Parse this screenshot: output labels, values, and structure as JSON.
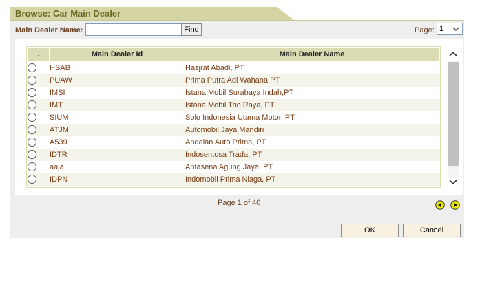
{
  "window": {
    "title": "Browse: Car Main Dealer"
  },
  "filter": {
    "label": "Main Dealer Name:",
    "value": "",
    "find_label": "Find"
  },
  "page_select": {
    "label": "Page:",
    "selected": "1"
  },
  "table": {
    "headers": {
      "select": ".",
      "id": "Main Dealer Id",
      "name": "Main Dealer Name"
    },
    "rows": [
      {
        "id": "HSAB",
        "name": "Hasjrat Abadi, PT"
      },
      {
        "id": "PUAW",
        "name": "Prima Putra Adi Wahana PT"
      },
      {
        "id": "IMSI",
        "name": "Istana Mobil Surabaya Indah,PT"
      },
      {
        "id": "IMT",
        "name": "Istana Mobil Trio Raya, PT"
      },
      {
        "id": "SIUM",
        "name": "Solo Indonesia Utama Motor, PT"
      },
      {
        "id": "ATJM",
        "name": "Automobil Jaya Mandiri"
      },
      {
        "id": "A539",
        "name": "Andalan Auto Prima, PT"
      },
      {
        "id": "IDTR",
        "name": "Indosentosa Trada, PT"
      },
      {
        "id": "aaja",
        "name": "Antasena Agung Jaya, PT"
      },
      {
        "id": "IDPN",
        "name": "Indomobil Prima Niaga, PT"
      }
    ]
  },
  "pager": {
    "text": "Page 1 of 40"
  },
  "buttons": {
    "ok": "OK",
    "cancel": "Cancel"
  },
  "icons": {
    "prev": "prev-page-icon",
    "next": "next-page-icon",
    "scroll_up": "chevron-up-icon",
    "scroll_down": "chevron-down-icon"
  },
  "colors": {
    "title_tab": "#d4d4a4",
    "title_text": "#6b6b24",
    "label_text": "#6b4226",
    "row_text": "#7a3f18",
    "header_bg": "#dcdcb4",
    "panel_bg": "#eeeeee",
    "nav_button": "#e8e800"
  }
}
